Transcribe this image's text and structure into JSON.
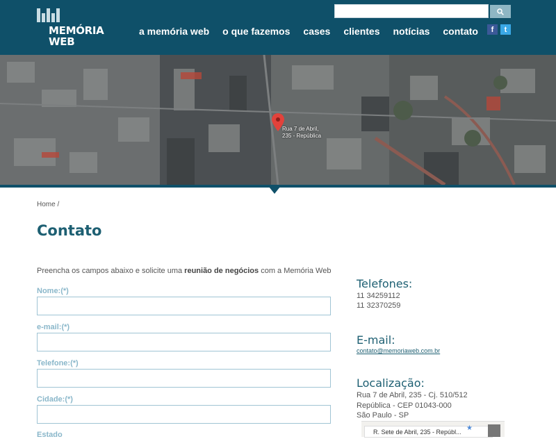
{
  "header": {
    "logo_line1": "MEMÓRIA",
    "logo_line2": "WEB",
    "nav": [
      "a memória web",
      "o que fazemos",
      "cases",
      "clientes",
      "notícias",
      "contato"
    ],
    "search_placeholder": "",
    "social": [
      "f",
      "t"
    ]
  },
  "map": {
    "pin_line1": "Rua 7 de Abril,",
    "pin_line2": "235 - República"
  },
  "breadcrumb": "Home /",
  "page_title": "Contato",
  "intro": {
    "before": "Preencha os campos abaixo e solicite uma ",
    "bold": "reunião de negócios",
    "after": " com a Memória Web"
  },
  "form": {
    "fields": [
      "Nome:(*)",
      "e-mail:(*)",
      "Telefone:(*)",
      "Cidade:(*)",
      "Estado"
    ]
  },
  "sidebar": {
    "phones_title": "Telefones:",
    "phone1": "11 34259112",
    "phone2": "11 32370259",
    "email_title": "E-mail:",
    "email": "contato@memoriaweb.com.br",
    "location_title": "Localização:",
    "addr1": "Rua 7 de Abril, 235 - Cj. 510/512",
    "addr2": "República - CEP 01043-000",
    "addr3": "São Paulo - SP",
    "minimap_label": "R. Sete de Abril, 235 - Repúbl..."
  },
  "colors": {
    "header_bg": "#0f5069",
    "title": "#1d5f72",
    "label": "#8ab7ca"
  }
}
